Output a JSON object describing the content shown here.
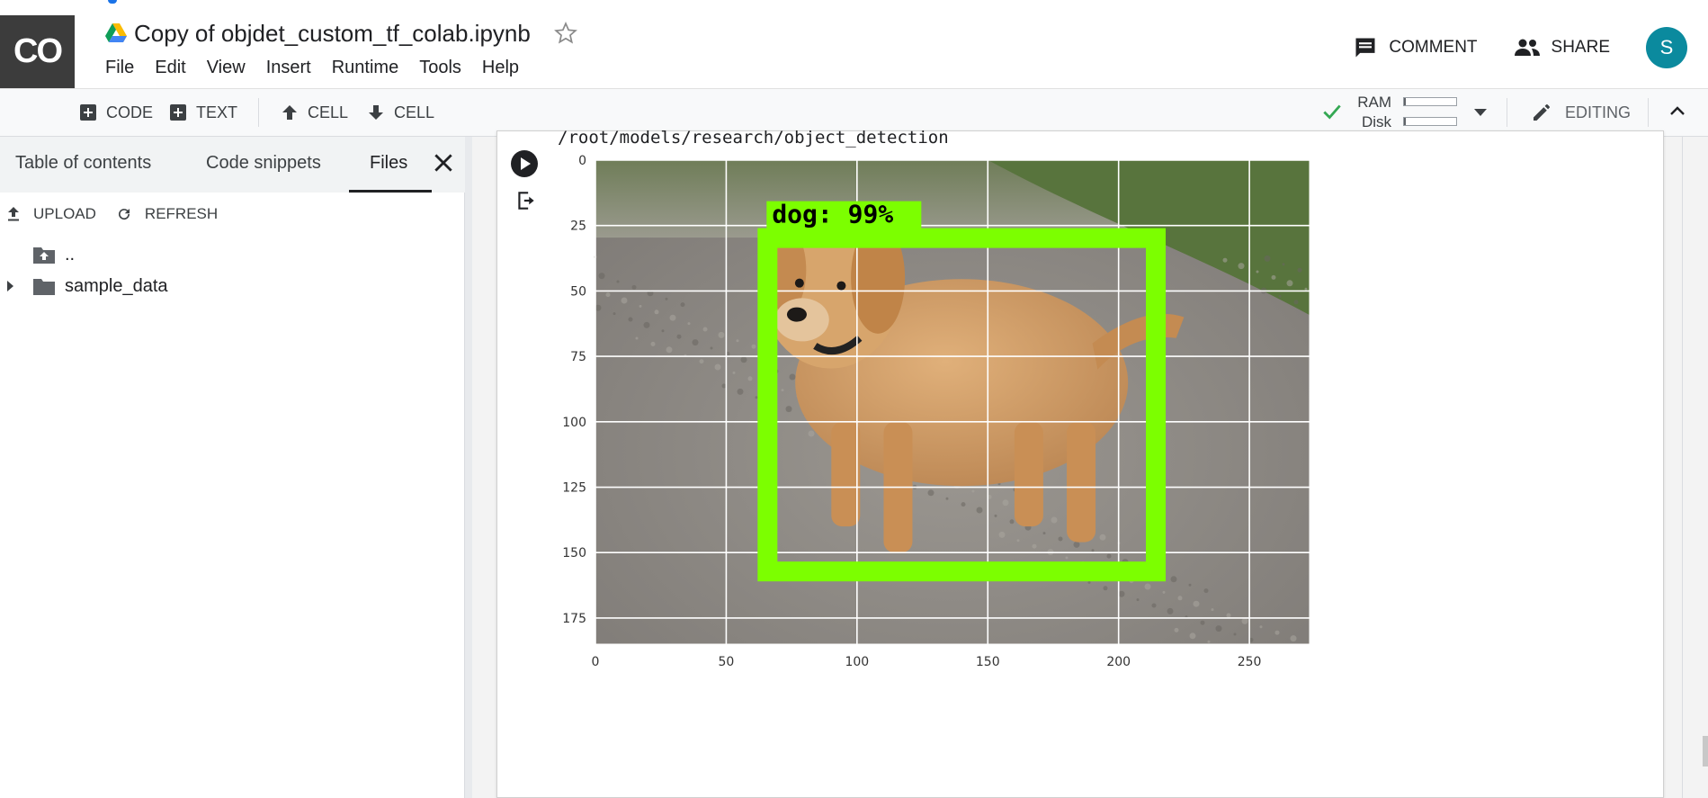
{
  "header": {
    "logo_text": "CO",
    "title": "Copy of objdet_custom_tf_colab.ipynb",
    "menu": [
      "File",
      "Edit",
      "View",
      "Insert",
      "Runtime",
      "Tools",
      "Help"
    ],
    "comment_label": "COMMENT",
    "share_label": "SHARE",
    "avatar_letter": "S",
    "avatar_color": "#0b8a9e"
  },
  "toolbar": {
    "code_label": "CODE",
    "text_label": "TEXT",
    "cell_up_label": "CELL",
    "cell_down_label": "CELL",
    "ram_label": "RAM",
    "disk_label": "Disk",
    "ram_fill": 0.04,
    "disk_fill": 0.03,
    "status_color": "#34a853",
    "editing_label": "EDITING"
  },
  "sidepanel": {
    "tabs": [
      "Table of contents",
      "Code snippets",
      "Files"
    ],
    "active_tab": "Files",
    "upload_label": "UPLOAD",
    "refresh_label": "REFRESH",
    "files": [
      {
        "name": "..",
        "type": "parent-folder"
      },
      {
        "name": "sample_data",
        "type": "folder",
        "expandable": true
      }
    ]
  },
  "cell": {
    "output_path": "/root/models/research/object_detection"
  },
  "figure": {
    "x_ticks": [
      0,
      50,
      100,
      150,
      200,
      250
    ],
    "y_ticks": [
      0,
      25,
      50,
      75,
      100,
      125,
      150,
      175
    ],
    "x_range": [
      0,
      273
    ],
    "y_range": [
      0,
      185
    ],
    "detection_label": "dog:  99%",
    "detection_box": {
      "xmin": 62,
      "ymin": 26,
      "xmax": 218,
      "ymax": 161
    },
    "box_color": "#7cff00",
    "label_bg": "#7cff00"
  }
}
